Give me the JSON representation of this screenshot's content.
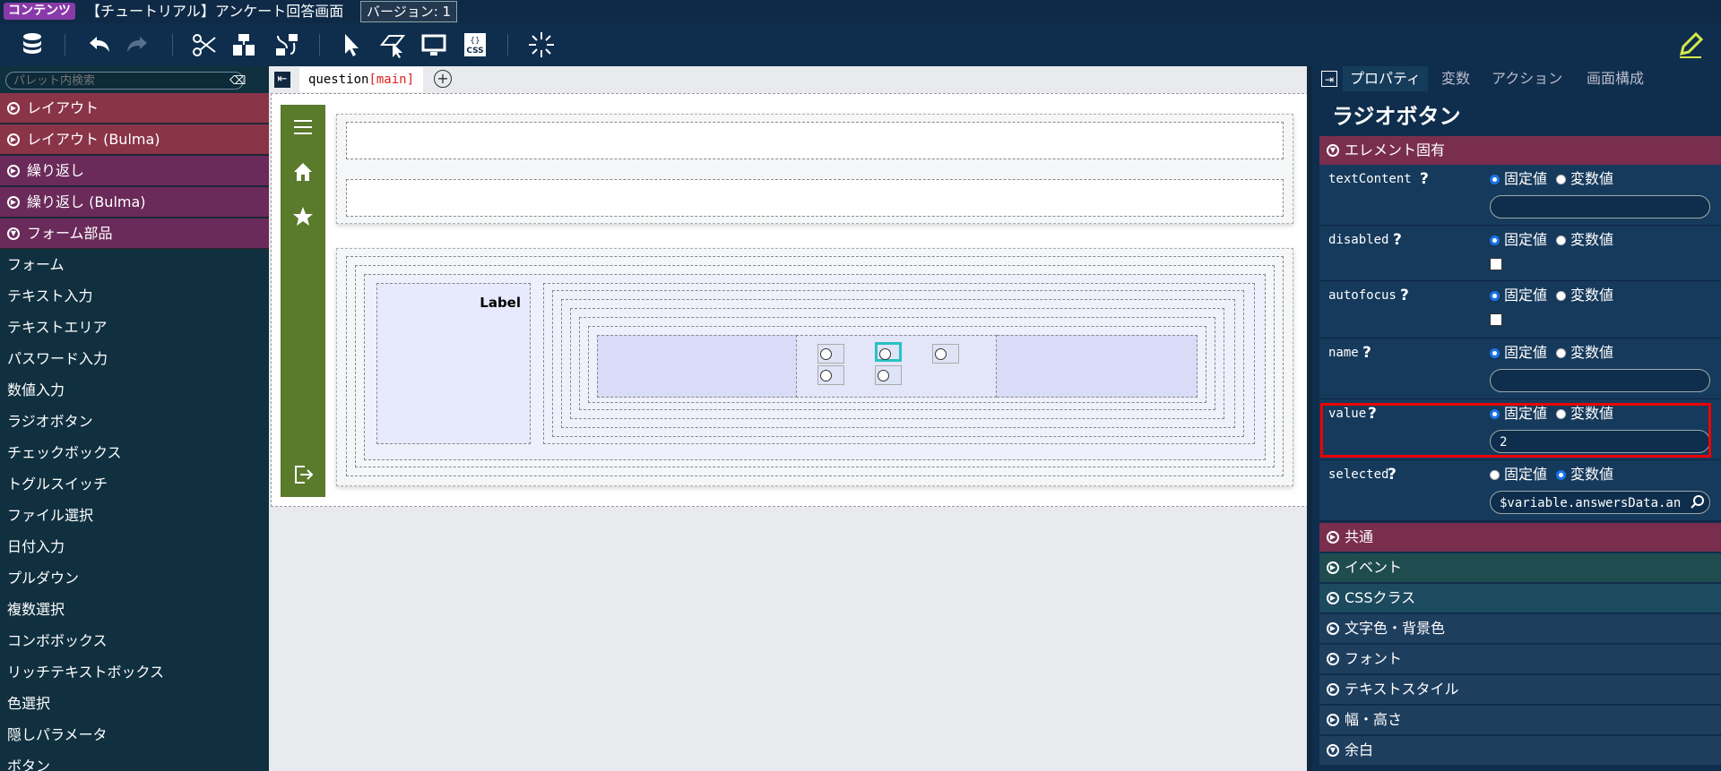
{
  "title_bar": {
    "content_badge": "コンテンツ",
    "page_name": "【チュートリアル】アンケート回答画面",
    "version_label": "バージョン: 1"
  },
  "palette": {
    "search_placeholder": "パレット内検索",
    "categories": [
      {
        "label": "レイアウト",
        "color": "#8a3448"
      },
      {
        "label": "レイアウト (Bulma)",
        "color": "#8a3448"
      },
      {
        "label": "繰り返し",
        "color": "#6a2a5a"
      },
      {
        "label": "繰り返し (Bulma)",
        "color": "#6a2a5a"
      },
      {
        "label": "フォーム部品",
        "color": "#6a2a5a"
      }
    ],
    "items": [
      "フォーム",
      "テキスト入力",
      "テキストエリア",
      "パスワード入力",
      "数値入力",
      "ラジオボタン",
      "チェックボックス",
      "トグルスイッチ",
      "ファイル選択",
      "日付入力",
      "プルダウン",
      "複数選択",
      "コンボボックス",
      "リッチテキストボックス",
      "色選択",
      "隠しパラメータ",
      "ボタン"
    ]
  },
  "canvas": {
    "tab_name": "question",
    "tab_suffix": "[main]",
    "label_text": "Label",
    "sidebar_color": "#5a7a2c"
  },
  "properties": {
    "tabs": [
      "プロパティ",
      "変数",
      "アクション",
      "画面構成"
    ],
    "element_title": "ラジオボタン",
    "section_specific": "エレメント固有",
    "mode_fixed": "固定値",
    "mode_variable": "変数値",
    "rows": {
      "textContent": {
        "name": "textContent",
        "value": ""
      },
      "disabled": {
        "name": "disabled"
      },
      "autofocus": {
        "name": "autofocus"
      },
      "name": {
        "name": "name",
        "value": ""
      },
      "value": {
        "name": "value",
        "value": "2"
      },
      "selected": {
        "name": "selected",
        "value": "$variable.answersData.an"
      }
    },
    "help_mark": "?",
    "sections": [
      {
        "label": "共通",
        "color": "#7a2e4e"
      },
      {
        "label": "イベント",
        "color": "#1f4c4e"
      },
      {
        "label": "CSSクラス",
        "color": "#1c4a5e"
      },
      {
        "label": "文字色・背景色",
        "color": "#1e3e5e"
      },
      {
        "label": "フォント",
        "color": "#1e3e5e"
      },
      {
        "label": "テキストスタイル",
        "color": "#1e3e5e"
      },
      {
        "label": "幅・高さ",
        "color": "#1e3e5e"
      },
      {
        "label": "余白",
        "color": "#1e3e5e"
      }
    ]
  }
}
